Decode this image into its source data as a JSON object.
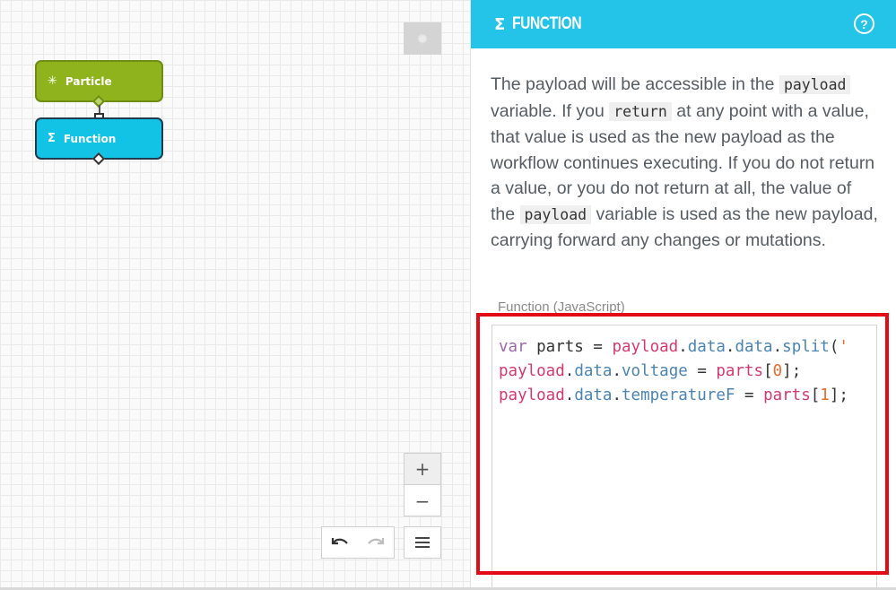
{
  "canvas": {
    "nodes": [
      {
        "label": "Particle",
        "icon": "particle-icon",
        "color": "#8fb31c"
      },
      {
        "label": "Function",
        "icon": "sigma-icon",
        "color": "#12c3e6"
      }
    ],
    "controls": {
      "zoom_in": "+",
      "zoom_out": "−"
    }
  },
  "panel": {
    "header": {
      "sigma": "Σ",
      "title": "FUNCTION",
      "help": "?",
      "color": "#24c3e8"
    },
    "description": {
      "part1": "The payload will be accessible in the ",
      "code1": "payload",
      "part2": " variable. If you ",
      "code2": "return",
      "part3": " at any point with a value, that value is used as the new payload as the workflow continues executing. If you do not return a value, or you do not return at all, the value of the ",
      "code3": "payload",
      "part4": " variable is used as the new payload, carrying forward any changes or mutations."
    },
    "field_label": "Function (JavaScript)",
    "code_lines": [
      "var parts = payload.data.data.split('",
      "payload.data.voltage = parts[0];",
      "payload.data.temperatureF = parts[1];"
    ]
  },
  "highlight_color": "#e30a16"
}
